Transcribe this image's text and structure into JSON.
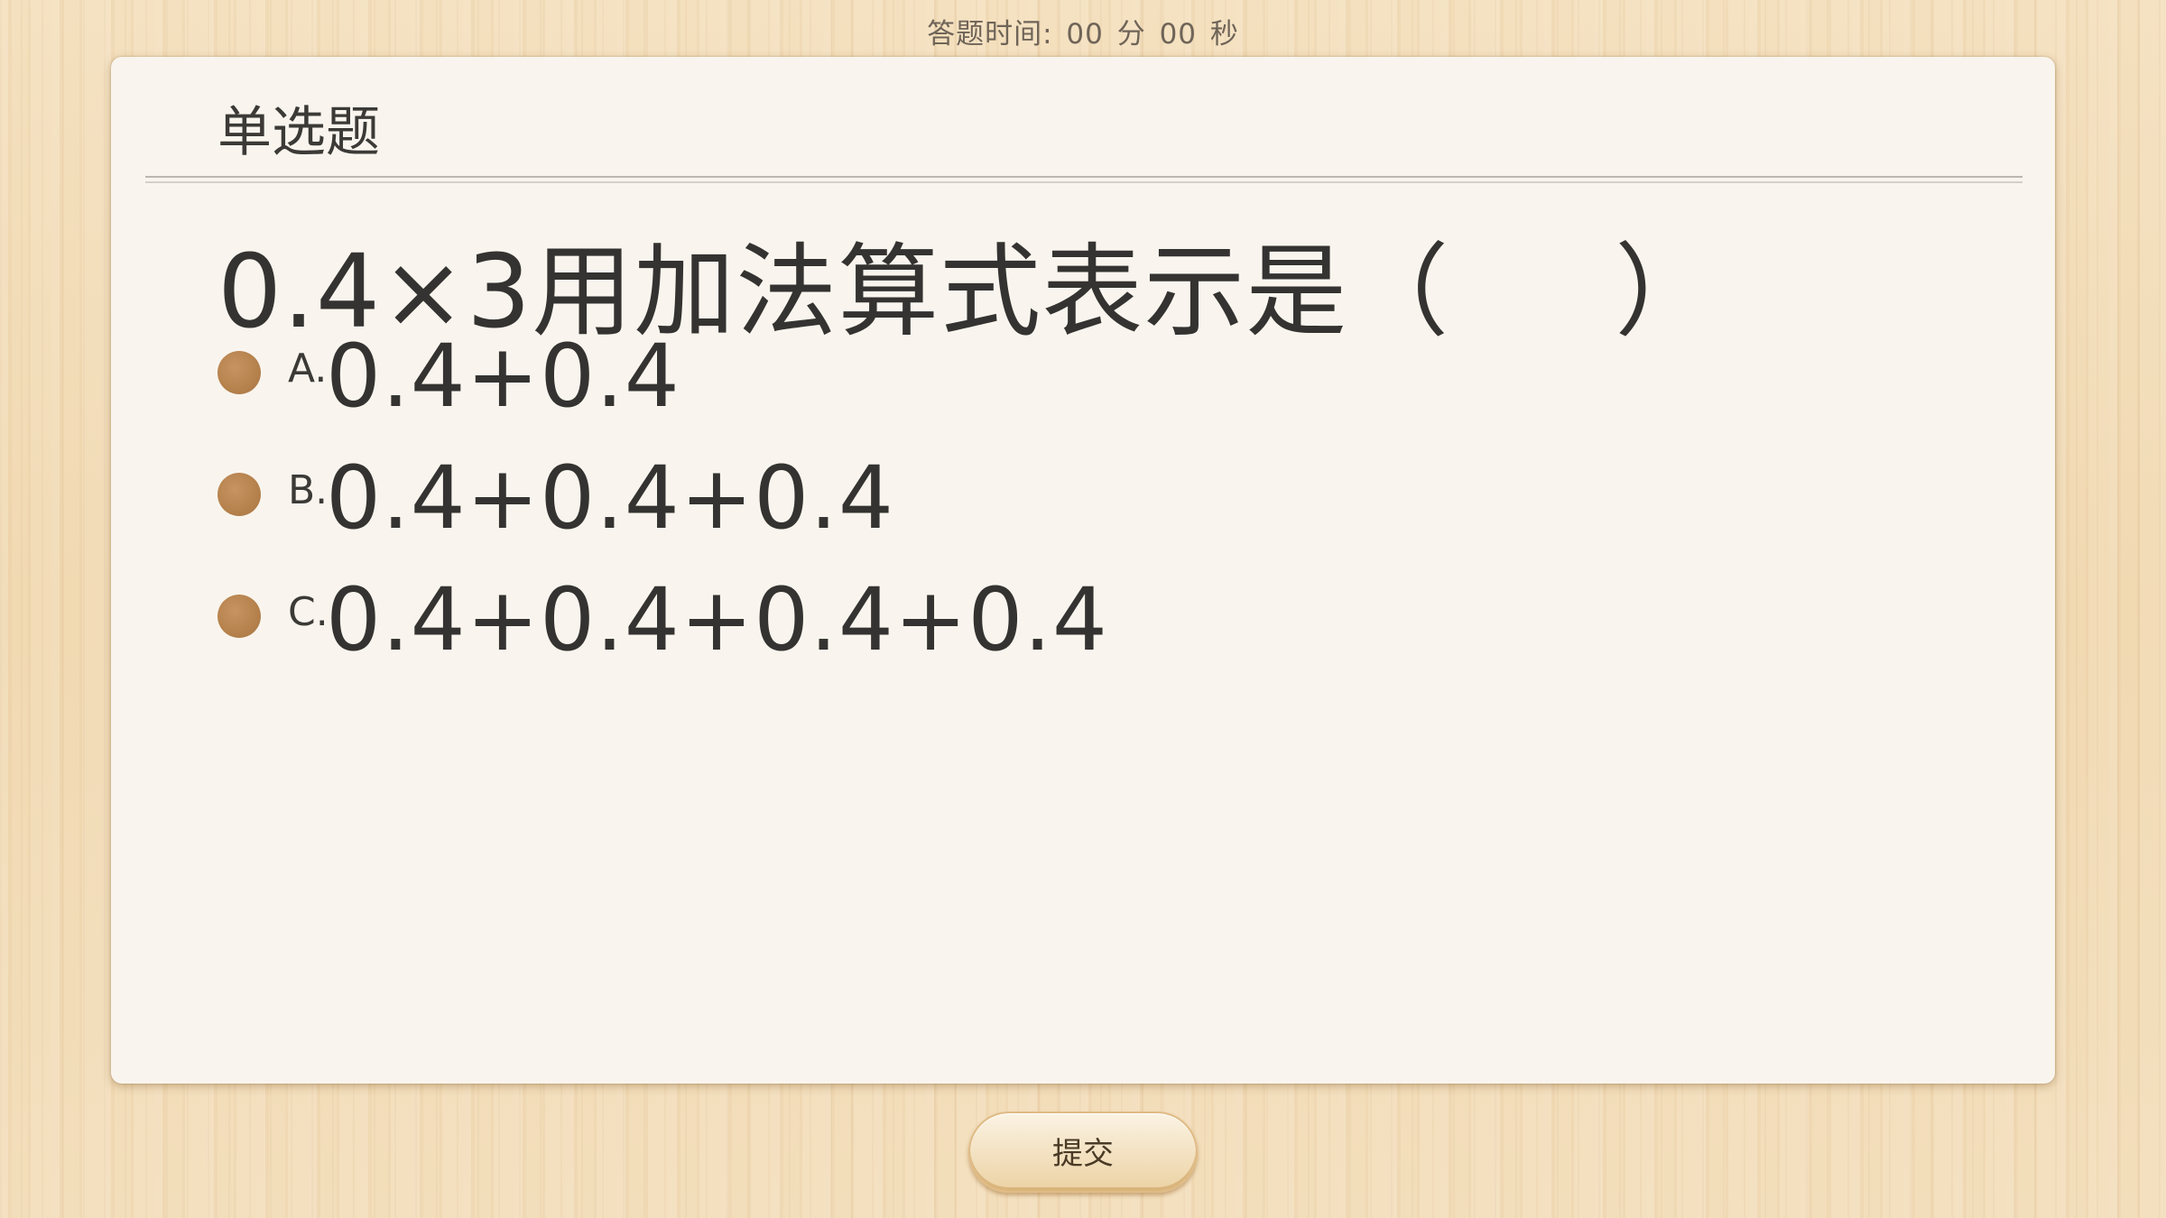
{
  "timer": {
    "label": "答题时间:",
    "minutes": "00",
    "min_unit": "分",
    "seconds": "00",
    "sec_unit": "秒"
  },
  "card": {
    "title": "单选题",
    "question": "0.4×3用加法算式表示是（     ）",
    "options": [
      {
        "letter": "A.",
        "text": "0.4+0.4"
      },
      {
        "letter": "B.",
        "text": "0.4+0.4+0.4"
      },
      {
        "letter": "C.",
        "text": "0.4+0.4+0.4+0.4"
      }
    ]
  },
  "submit_label": "提交",
  "colors": {
    "radio": "#b5814c",
    "card_bg": "#f9f5ee",
    "text": "#353331"
  }
}
